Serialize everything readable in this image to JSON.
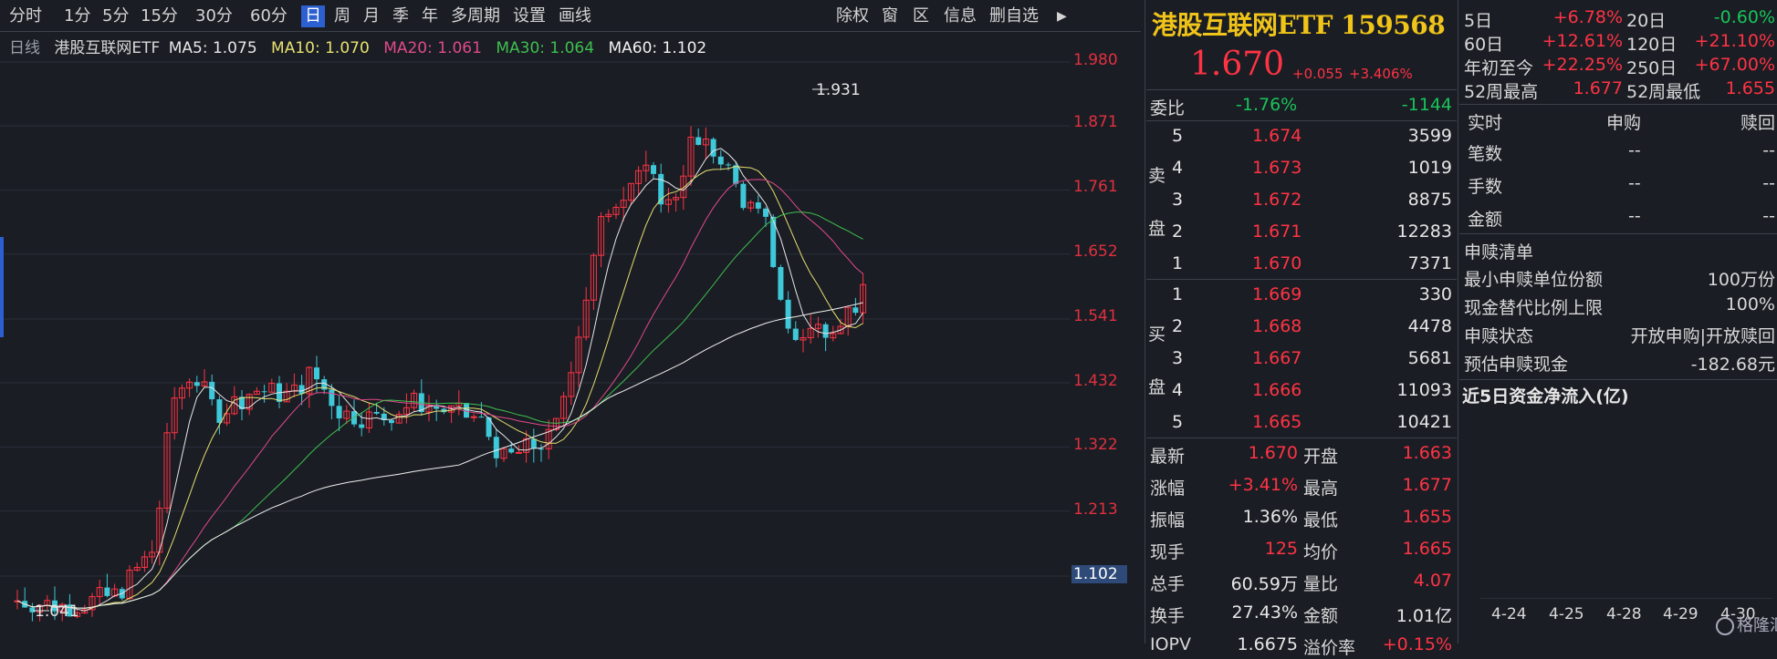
{
  "toolbar": {
    "items": [
      "分时",
      "1分",
      "5分",
      "15分",
      "30分",
      "60分",
      "日",
      "周",
      "月",
      "季",
      "年",
      "多周期",
      "设置",
      "画线"
    ],
    "right_items": [
      "除权",
      "窗",
      "区",
      "信息",
      "删自选"
    ],
    "arrow_icon": "arrow-right-icon"
  },
  "ma_info": {
    "period": "日线",
    "name": "港股互联网ETF",
    "ma5": "MA5: 1.075",
    "ma10": "MA10: 1.070",
    "ma20": "MA20: 1.061",
    "ma30": "MA30: 1.064",
    "ma60": "MA60: 1.102"
  },
  "colors": {
    "up": "#ff3343",
    "down": "#3ec8d8",
    "ma5": "#e6e6e6",
    "ma10": "#e8e070",
    "ma20": "#e04a8a",
    "ma30": "#3fbf4f",
    "ma60": "#f0f0f0",
    "bg": "#1a1d24"
  },
  "price_axis": {
    "ticks": [
      "1.980",
      "1.871",
      "1.761",
      "1.652",
      "1.541",
      "1.432",
      "1.322",
      "1.213",
      "1.102"
    ],
    "highlight": "1.102"
  },
  "chart_annotations": {
    "high": "1.931",
    "low": "1.041"
  },
  "stock": {
    "title": "港股互联网ETF 159568",
    "price": "1.670",
    "change": "+0.055",
    "change_pct": "+3.406%"
  },
  "orderbook": {
    "weibi_label": "委比",
    "weibi_pct": "-1.76%",
    "weibi_val": "-1144",
    "sell_label": [
      "卖",
      "盘"
    ],
    "buy_label": [
      "买",
      "盘"
    ],
    "asks": [
      {
        "lvl": "5",
        "price": "1.674",
        "vol": "3599"
      },
      {
        "lvl": "4",
        "price": "1.673",
        "vol": "1019"
      },
      {
        "lvl": "3",
        "price": "1.672",
        "vol": "8875"
      },
      {
        "lvl": "2",
        "price": "1.671",
        "vol": "12283"
      },
      {
        "lvl": "1",
        "price": "1.670",
        "vol": "7371"
      }
    ],
    "bids": [
      {
        "lvl": "1",
        "price": "1.669",
        "vol": "330"
      },
      {
        "lvl": "2",
        "price": "1.668",
        "vol": "4478"
      },
      {
        "lvl": "3",
        "price": "1.667",
        "vol": "5681"
      },
      {
        "lvl": "4",
        "price": "1.666",
        "vol": "11093"
      },
      {
        "lvl": "5",
        "price": "1.665",
        "vol": "10421"
      }
    ]
  },
  "quote": [
    {
      "l1": "最新",
      "v1": "1.670",
      "l2": "开盘",
      "v2": "1.663"
    },
    {
      "l1": "涨幅",
      "v1": "+3.41%",
      "l2": "最高",
      "v2": "1.677"
    },
    {
      "l1": "振幅",
      "v1": "1.36%",
      "l2": "最低",
      "v2": "1.655"
    },
    {
      "l1": "现手",
      "v1": "125",
      "l2": "均价",
      "v2": "1.665"
    },
    {
      "l1": "总手",
      "v1": "60.59万",
      "l2": "量比",
      "v2": "4.07"
    },
    {
      "l1": "换手",
      "v1": "27.43%",
      "l2": "金额",
      "v2": "1.01亿"
    },
    {
      "l1": "IOPV",
      "v1": "1.6675",
      "l2": "溢价率",
      "v2": "+0.15%"
    }
  ],
  "periods": [
    {
      "l1": "5日",
      "v1": "+6.78%",
      "l2": "20日",
      "v2": "-0.60%"
    },
    {
      "l1": "60日",
      "v1": "+12.61%",
      "l2": "120日",
      "v2": "+21.10%"
    },
    {
      "l1": "年初至今",
      "v1": "+22.25%",
      "l2": "250日",
      "v2": "+67.00%"
    },
    {
      "l1": "52周最高",
      "v1": "1.677",
      "l2": "52周最低",
      "v2": "1.655"
    }
  ],
  "redeem_table": {
    "headers": [
      "实时",
      "申购",
      "赎回"
    ],
    "rows": [
      {
        "label": "笔数",
        "a": "--",
        "b": "--"
      },
      {
        "label": "手数",
        "a": "--",
        "b": "--"
      },
      {
        "label": "金额",
        "a": "--",
        "b": "--"
      }
    ]
  },
  "redeem_list": {
    "title": "申赎清单",
    "rows": [
      {
        "label": "最小申赎单位份额",
        "value": "100万份"
      },
      {
        "label": "现金替代比例上限",
        "value": "100%"
      },
      {
        "label": "申赎状态",
        "value": "开放申购|开放赎回"
      },
      {
        "label": "预估申赎现金",
        "value": "-182.68元"
      }
    ]
  },
  "fund_flow": {
    "title": "近5日资金净流入(亿)",
    "dates": [
      "4-24",
      "4-25",
      "4-28",
      "4-29",
      "4-30"
    ]
  },
  "watermark": "格隆汇"
}
